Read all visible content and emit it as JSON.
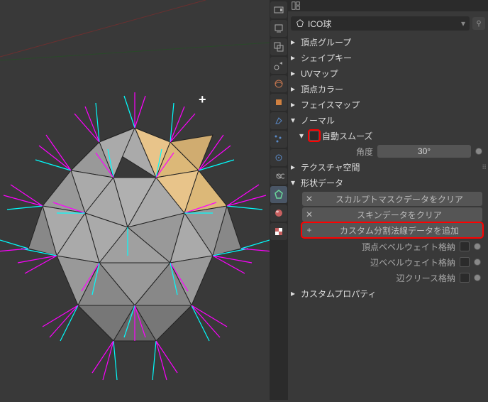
{
  "object_name": "ICO球",
  "sections": {
    "vertex_groups": "頂点グループ",
    "shape_keys": "シェイプキー",
    "uv_maps": "UVマップ",
    "vertex_colors": "頂点カラー",
    "face_maps": "フェイスマップ",
    "normals": "ノーマル",
    "auto_smooth": "自動スムーズ",
    "angle_label": "角度",
    "angle_value": "30°",
    "texture_space": "テクスチャ空間",
    "geometry_data": "形状データ",
    "clear_sculpt_mask": "スカルプトマスクデータをクリア",
    "clear_skin": "スキンデータをクリア",
    "add_custom_split_normals": "カスタム分割法線データを追加",
    "store_vertex_bevel": "頂点ベベルウェイト格納",
    "store_edge_bevel": "辺ベベルウェイト格納",
    "store_edge_crease": "辺クリース格納",
    "custom_properties": "カスタムプロパティ"
  }
}
